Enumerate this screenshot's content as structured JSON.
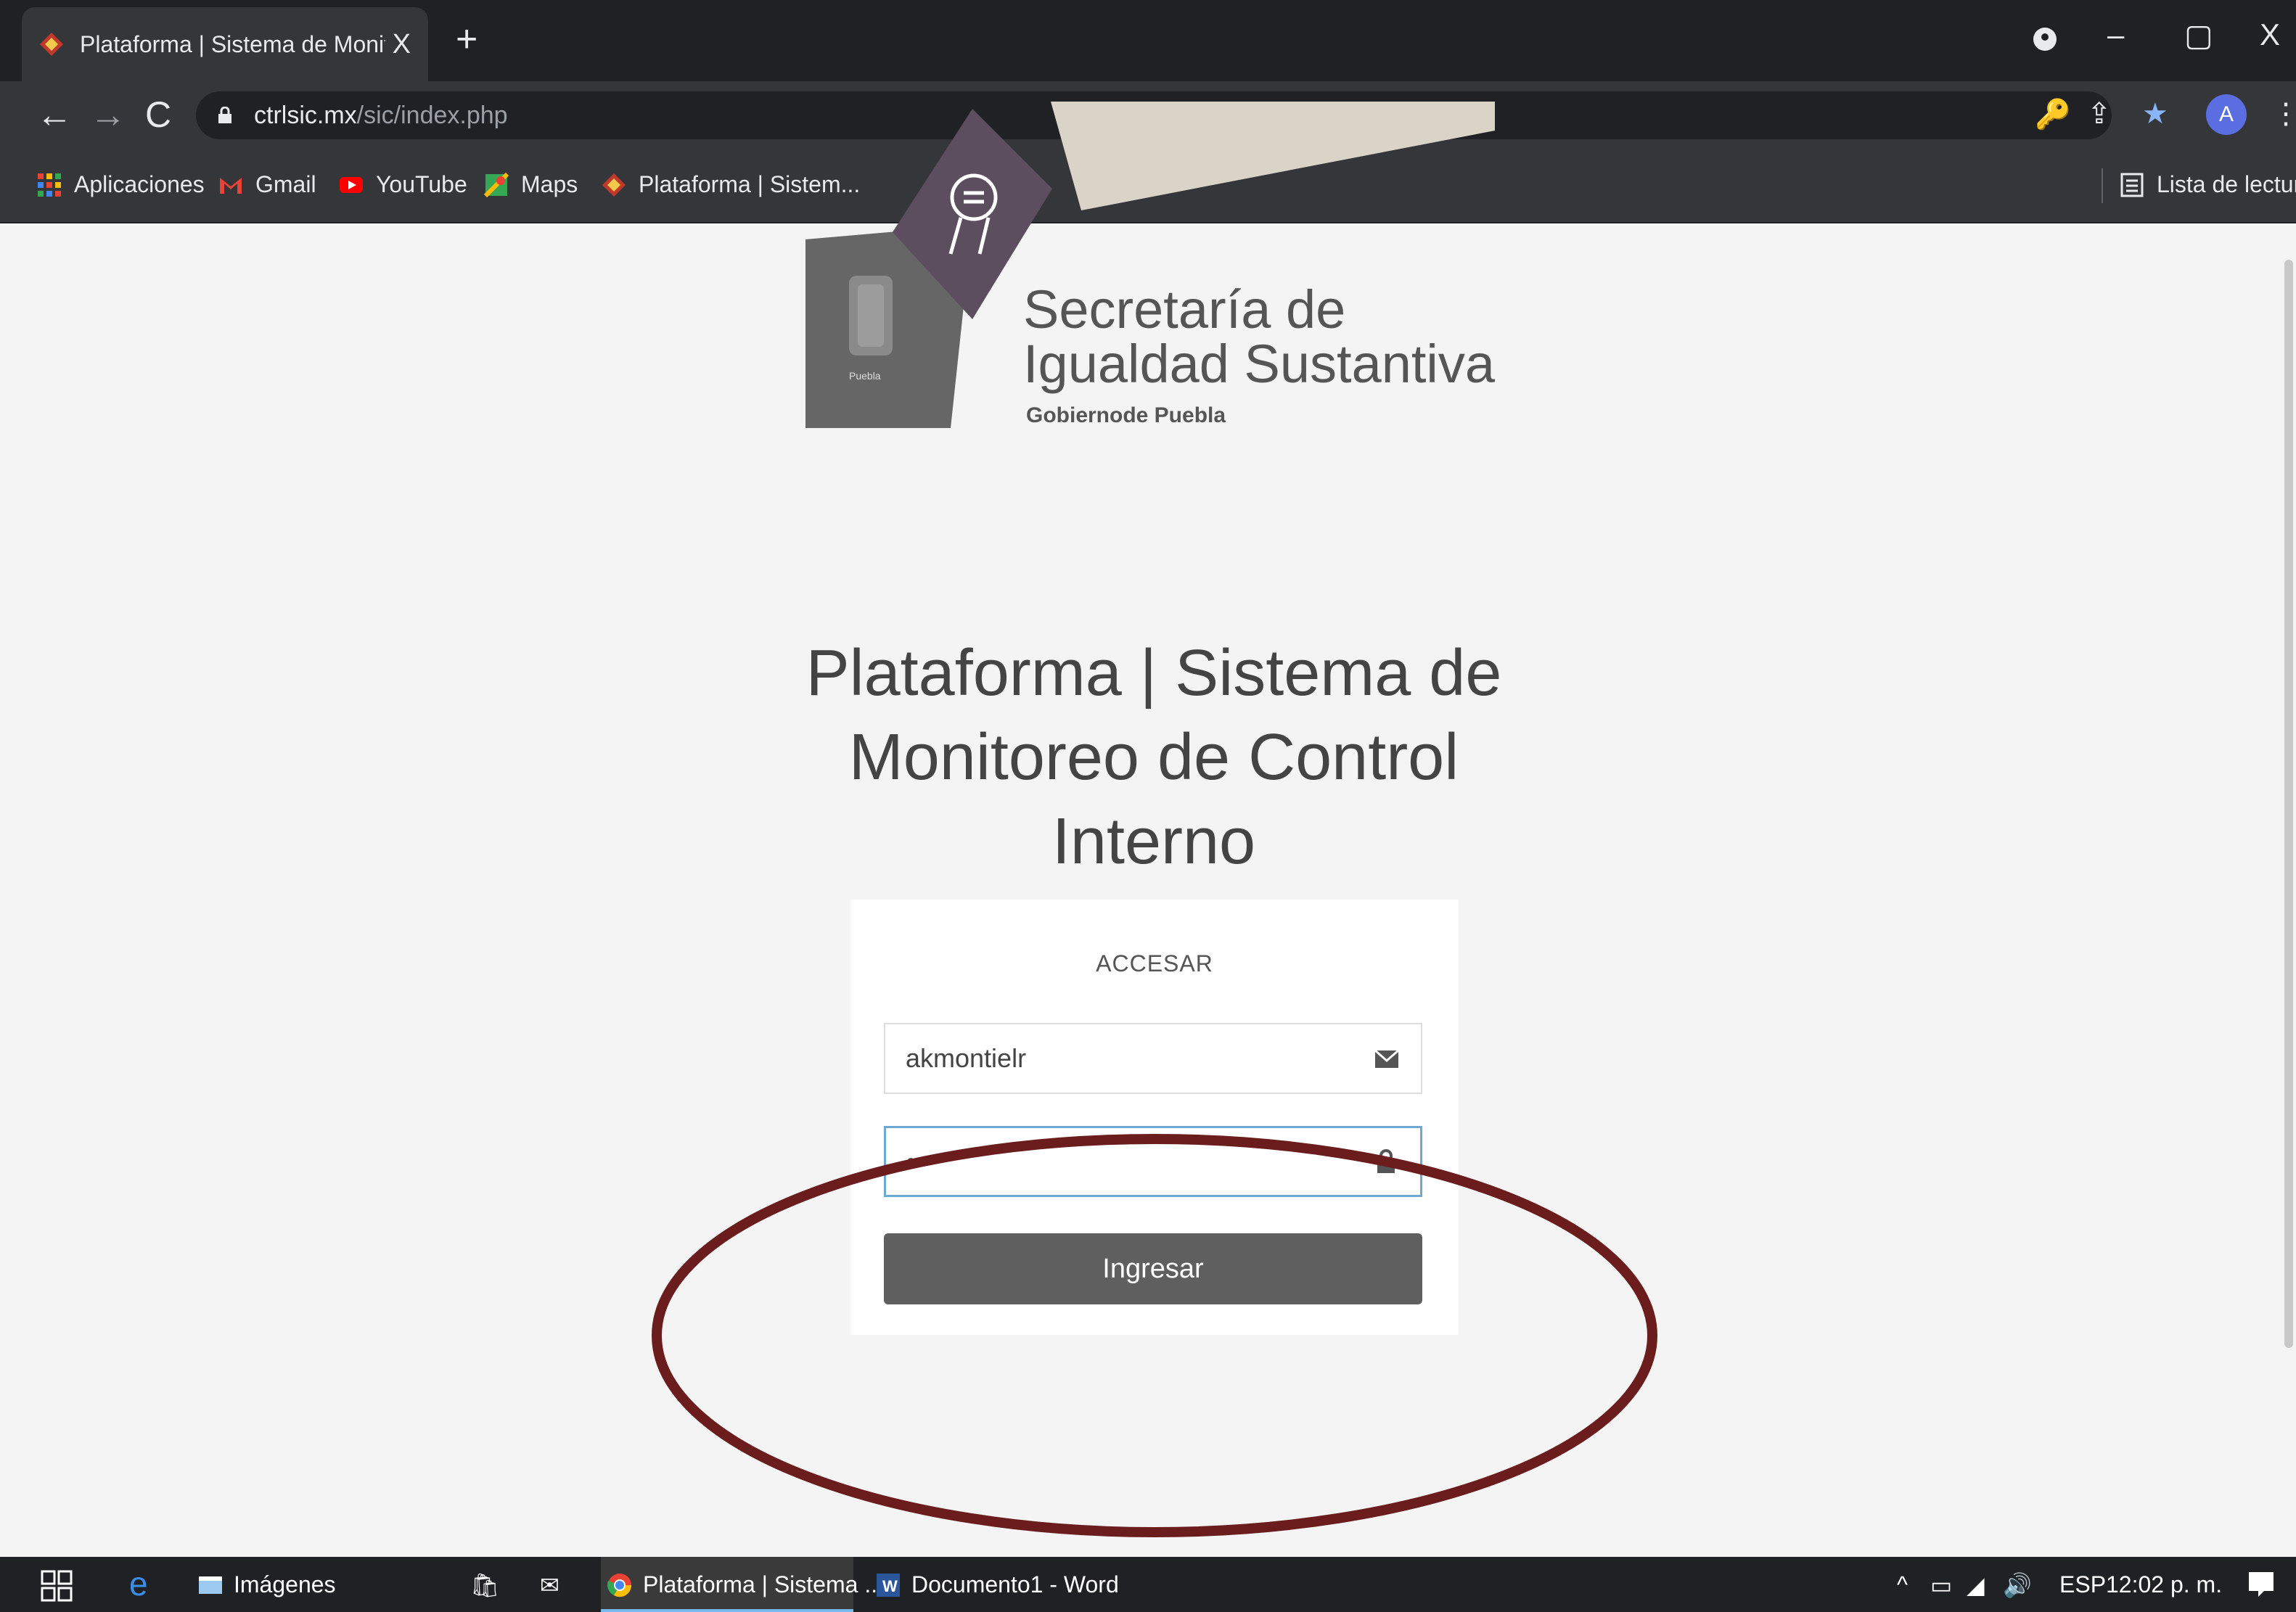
{
  "browser": {
    "tab_title": "Plataforma | Sistema de Monitor",
    "tab_close": "X",
    "new_tab": "+",
    "window_controls": {
      "minimize": "–",
      "restore": "▢",
      "close": "X"
    },
    "url_domain": "ctrlsic.mx",
    "url_path": "/sic/index.php",
    "avatar_letter": "A",
    "bookmarks": [
      "Aplicaciones",
      "Gmail",
      "YouTube",
      "Maps",
      "Plataforma | Sistem..."
    ],
    "reading_list": "Lista de lectura"
  },
  "logo": {
    "line1": "Secretaría de",
    "line2": "Igualdad Sustantiva",
    "line3": "Gobiernode Puebla",
    "seal_caption": "Puebla"
  },
  "page": {
    "title": "Plataforma | Sistema de Monitoreo de Control Interno"
  },
  "login": {
    "heading": "ACCESAR",
    "username_value": "akmontielr",
    "password_value": "•••",
    "submit_label": "Ingresar"
  },
  "taskbar": {
    "items": [
      "Imágenes",
      "Plataforma | Sistema ...",
      "Documento1 - Word"
    ],
    "language": "ESP",
    "time": "12:02 p. m."
  },
  "colors": {
    "logo_purple": "#5c4d5f",
    "logo_gray": "#666666",
    "logo_beige": "#d9d3c8",
    "annotation_ellipse": "#6b1d1d",
    "input_focus": "#6fa8d3"
  }
}
